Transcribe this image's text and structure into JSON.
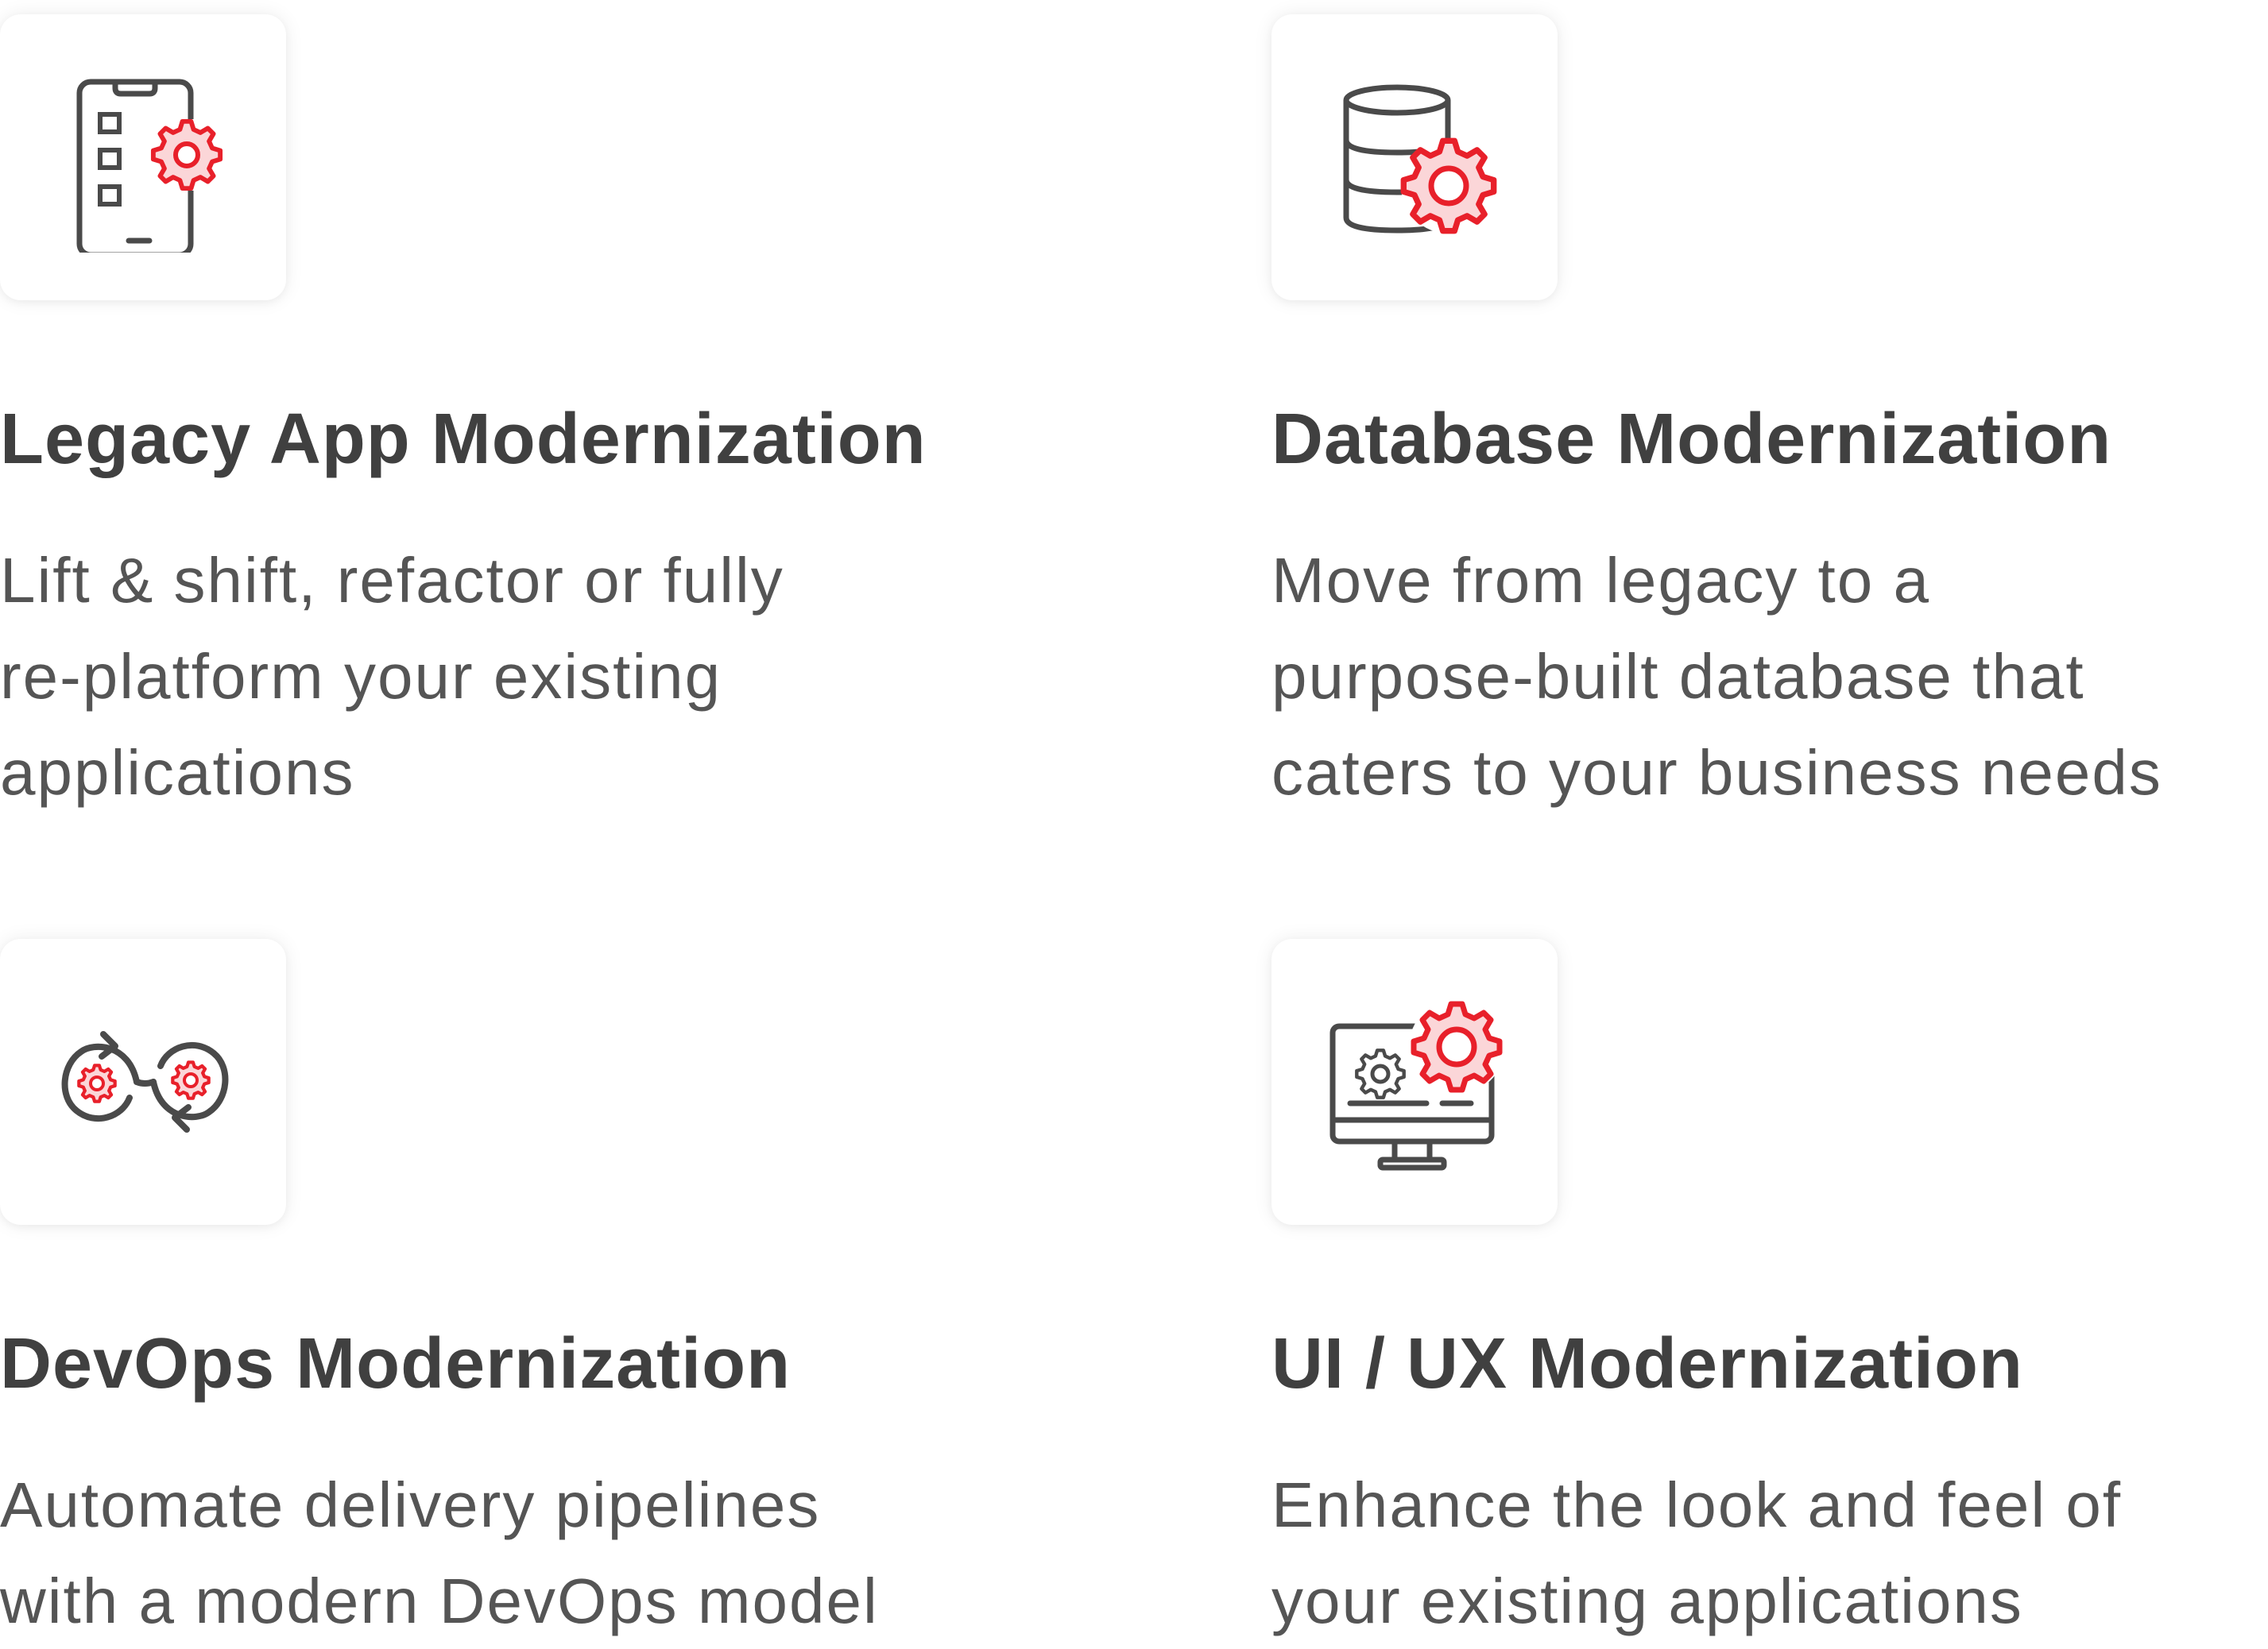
{
  "colors": {
    "accent": "#e8202a",
    "accent_fill": "#fbd6d8",
    "icon_gray": "#4a4a4a",
    "heading": "#404040",
    "body": "#555555"
  },
  "cards": [
    {
      "icon": "mobile-app-gear-icon",
      "title": "Legacy App Modernization",
      "lines": [
        "Lift & shift, refactor or fully",
        "re-platform your existing",
        "applications"
      ]
    },
    {
      "icon": "database-gear-icon",
      "title": "Database Modernization",
      "lines": [
        "Move from legacy to a",
        "purpose-built database that",
        "caters to your business needs"
      ]
    },
    {
      "icon": "devops-loop-gears-icon",
      "title": "DevOps Modernization",
      "lines": [
        "Automate delivery pipelines",
        "with a modern DevOps model"
      ]
    },
    {
      "icon": "monitor-gears-icon",
      "title": "UI / UX Modernization",
      "lines": [
        "Enhance the look and feel of",
        "your existing applications"
      ]
    }
  ]
}
